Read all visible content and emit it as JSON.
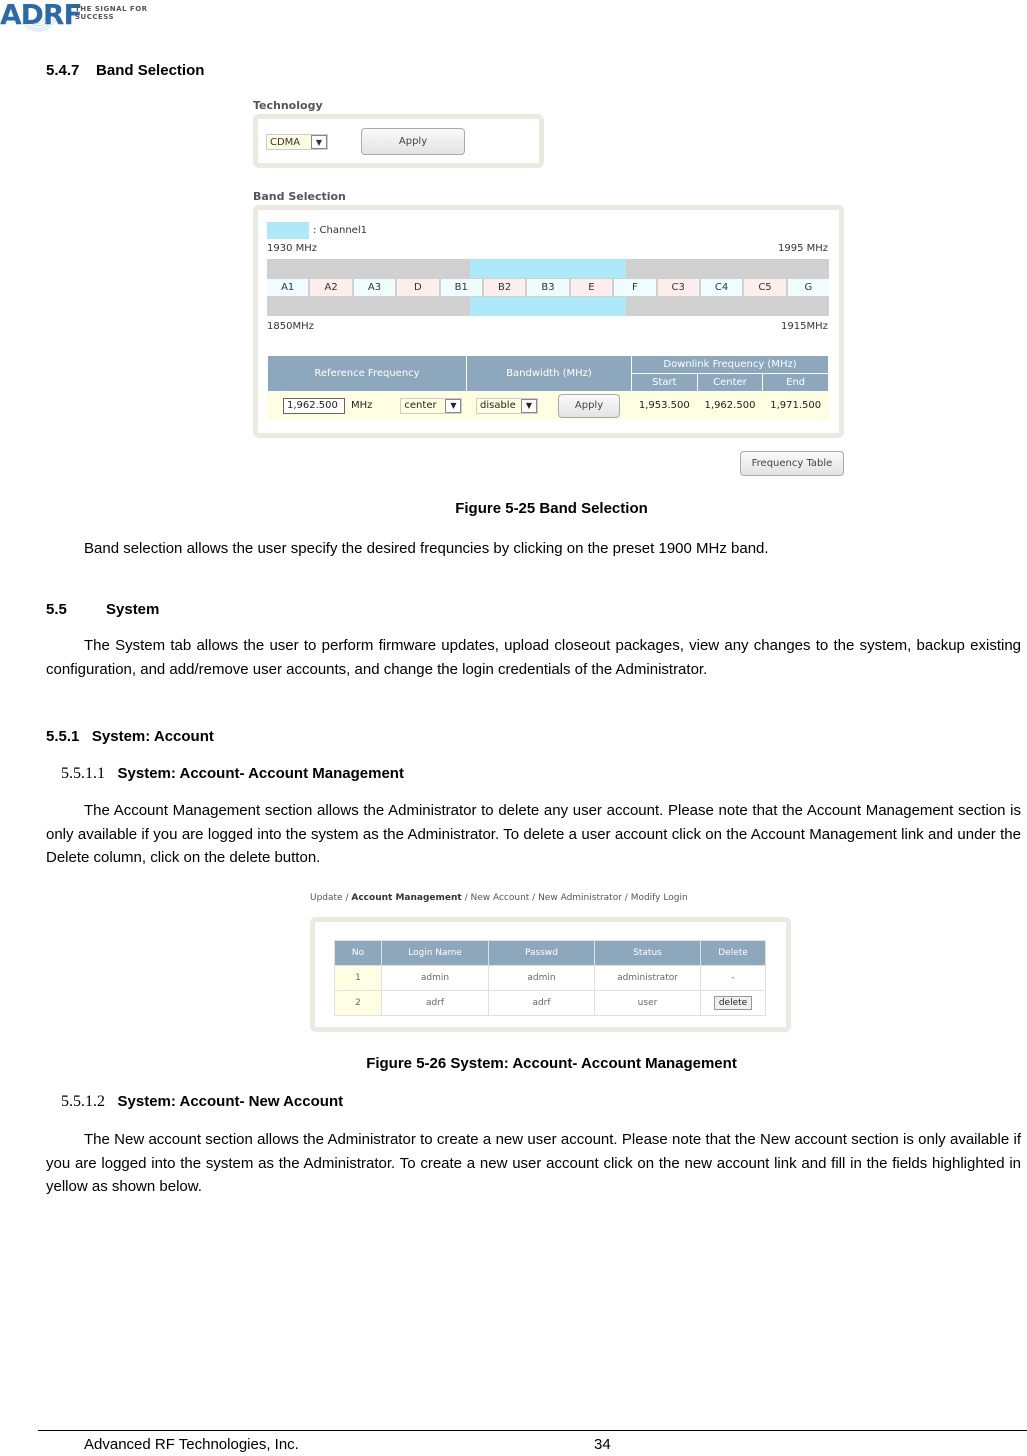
{
  "header": {
    "logo_text": "ADRF",
    "tagline": "THE SIGNAL FOR SUCCESS"
  },
  "section_547": {
    "number": "5.4.7",
    "title": "Band Selection"
  },
  "figure_25": {
    "technology": {
      "title": "Technology",
      "select_value": "CDMA",
      "apply_label": "Apply"
    },
    "band_selection": {
      "title": "Band Selection",
      "legend_label": ": Channel1",
      "legend_color": "#aee9f9",
      "top_left_label": "1930 MHz",
      "top_right_label": "1995 MHz",
      "bottom_left_label": "1850MHz",
      "bottom_right_label": "1915MHz",
      "bands": [
        "A1",
        "A2",
        "A3",
        "D",
        "B1",
        "B2",
        "B3",
        "E",
        "F",
        "C3",
        "C4",
        "C5",
        "G"
      ],
      "selected_bands": [
        "B2",
        "B3",
        "E"
      ],
      "table": {
        "headers": {
          "reference_frequency": "Reference Frequency",
          "bandwidth": "Bandwidth (MHz)",
          "downlink": "Downlink Frequency (MHz)",
          "start": "Start",
          "center": "Center",
          "end": "End"
        },
        "row": {
          "ref_freq_value": "1,962.500",
          "ref_unit": "MHz",
          "position_select": "center",
          "bandwidth_select": "disable",
          "apply_label": "Apply",
          "start": "1,953.500",
          "center": "1,962.500",
          "end": "1,971.500"
        }
      },
      "frequency_table_button": "Frequency Table"
    },
    "caption": "Figure 5-25   Band Selection"
  },
  "para_band": "Band selection allows the user specify the desired frequncies by clicking on the preset 1900 MHz band.",
  "section_55": {
    "number": "5.5",
    "title": "System",
    "body": "The System tab allows the user to perform firmware updates, upload closeout packages, view any changes to the system, backup existing configuration, and add/remove user accounts, and change the login credentials of the Administrator."
  },
  "section_551": {
    "number": "5.5.1",
    "title": "System: Account"
  },
  "section_5511": {
    "number": "5.5.1.1",
    "title": "System: Account- Account Management",
    "body": "The Account Management section allows the Administrator to delete any user account.  Please note that the Account Management section is only available if you are logged into the system as the Administrator.  To delete a user account click on the Account Management link and under the Delete column, click on the delete button."
  },
  "figure_26": {
    "nav": {
      "items": [
        "Update",
        "Account Management",
        "New Account",
        "New Administrator",
        "Modify Login"
      ],
      "active": "Account Management",
      "separator": " / "
    },
    "table": {
      "headers": [
        "No",
        "Login Name",
        "Passwd",
        "Status",
        "Delete"
      ],
      "rows": [
        {
          "no": "1",
          "login": "admin",
          "passwd": "admin",
          "status": "administrator",
          "delete": "-"
        },
        {
          "no": "2",
          "login": "adrf",
          "passwd": "adrf",
          "status": "user",
          "delete": "delete"
        }
      ]
    },
    "caption": "Figure 5-26   System: Account- Account Management"
  },
  "section_5512": {
    "number": "5.5.1.2",
    "title": "System: Account- New Account",
    "body": "The New account section allows the Administrator to create a new user account.  Please note that the New account section is only available if you are logged into the system as the Administrator.  To create a new user account click on the new account link and fill in the fields highlighted in yellow as shown below."
  },
  "footer": {
    "company": "Advanced RF Technologies, Inc.",
    "page": "34"
  }
}
